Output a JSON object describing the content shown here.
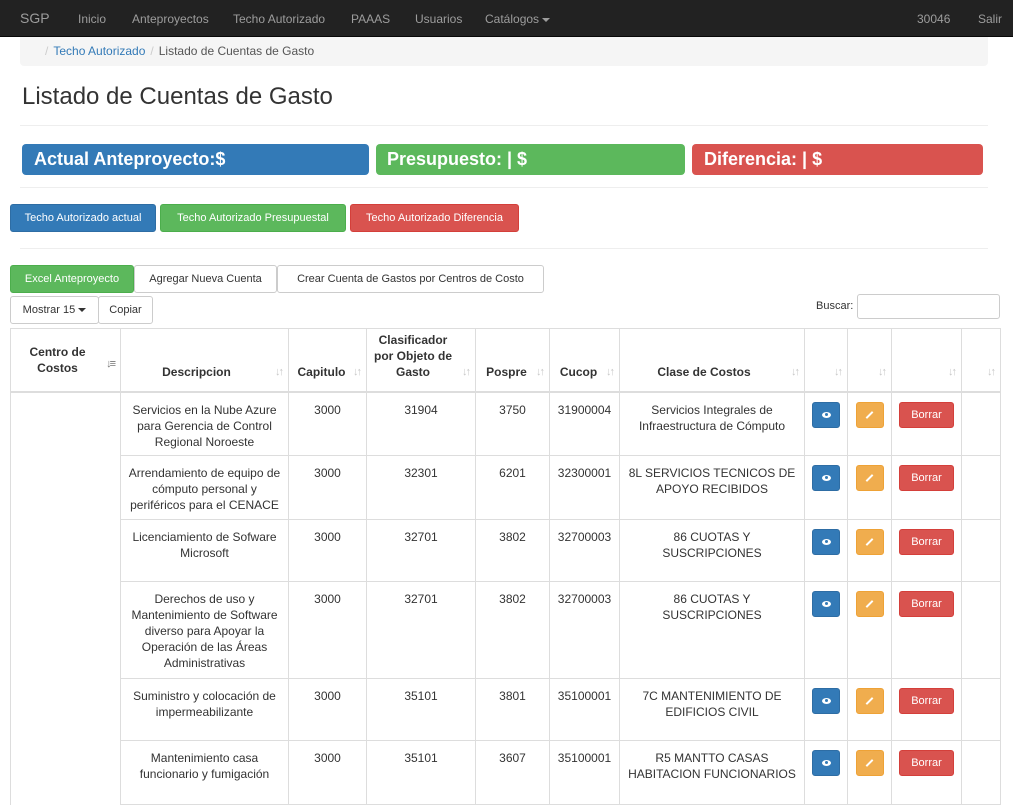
{
  "navbar": {
    "brand": "SGP",
    "items": [
      "Inicio",
      "Anteproyectos",
      "Techo Autorizado",
      "PAAAS",
      "Usuarios",
      "Catálogos"
    ],
    "user": "30046",
    "logout": "Salir"
  },
  "breadcrumb": {
    "link": "Techo Autorizado",
    "current": "Listado de Cuentas de Gasto"
  },
  "page_title": "Listado de Cuentas de Gasto",
  "summary": {
    "actual": "Actual Anteproyecto:$",
    "presupuesto": "Presupuesto: |    $",
    "diferencia": "Diferencia:     | $"
  },
  "colors": {
    "primary": "#337ab7",
    "success": "#5cb85c",
    "danger": "#d9534f",
    "warning": "#f0ad4e",
    "navbar": "#222222"
  },
  "techo_buttons": {
    "actual": "Techo Autorizado actual",
    "presupuestal": "Techo Autorizado Presupuestal",
    "diferencia": "Techo Autorizado Diferencia"
  },
  "action_buttons": {
    "excel": "Excel Anteproyecto",
    "agregar": "Agregar Nueva Cuenta",
    "crear": "Crear Cuenta de Gastos por Centros de Costo"
  },
  "table_tools": {
    "mostrar": "Mostrar 15",
    "copiar": "Copiar",
    "buscar_label": "Buscar:",
    "buscar_value": ""
  },
  "table": {
    "headers": {
      "centro": "Centro de Costos",
      "descripcion": "Descripcion",
      "capitulo": "Capitulo",
      "clasificador": "Clasificador por Objeto de Gasto",
      "pospre": "Pospre",
      "cucop": "Cucop",
      "clase": "Clase de Costos"
    },
    "delete_label": "Borrar",
    "rows": [
      {
        "descripcion": "Servicios en la Nube Azure para Gerencia de Control Regional Noroeste",
        "capitulo": "3000",
        "clasificador": "31904",
        "pospre": "3750",
        "cucop": "31900004",
        "clase": "Servicios Integrales de Infraestructura de Cómputo"
      },
      {
        "descripcion": "Arrendamiento de equipo de cómputo personal y periféricos para el CENACE",
        "capitulo": "3000",
        "clasificador": "32301",
        "pospre": "6201",
        "cucop": "32300001",
        "clase": "8L SERVICIOS TECNICOS DE APOYO RECIBIDOS"
      },
      {
        "descripcion": "Licenciamiento de Sofware Microsoft",
        "capitulo": "3000",
        "clasificador": "32701",
        "pospre": "3802",
        "cucop": "32700003",
        "clase": "86 CUOTAS Y SUSCRIPCIONES"
      },
      {
        "descripcion": "Derechos de uso y Mantenimiento de Software diverso para Apoyar la Operación de las Áreas Administrativas",
        "capitulo": "3000",
        "clasificador": "32701",
        "pospre": "3802",
        "cucop": "32700003",
        "clase": "86 CUOTAS Y SUSCRIPCIONES"
      },
      {
        "descripcion": "Suministro y colocación de impermeabilizante",
        "capitulo": "3000",
        "clasificador": "35101",
        "pospre": "3801",
        "cucop": "35100001",
        "clase": "7C MANTENIMIENTO DE EDIFICIOS CIVIL"
      },
      {
        "descripcion": "Mantenimiento casa funcionario y fumigación",
        "capitulo": "3000",
        "clasificador": "35101",
        "pospre": "3607",
        "cucop": "35100001",
        "clase": "R5 MANTTO CASAS HABITACION FUNCIONARIOS"
      }
    ]
  }
}
